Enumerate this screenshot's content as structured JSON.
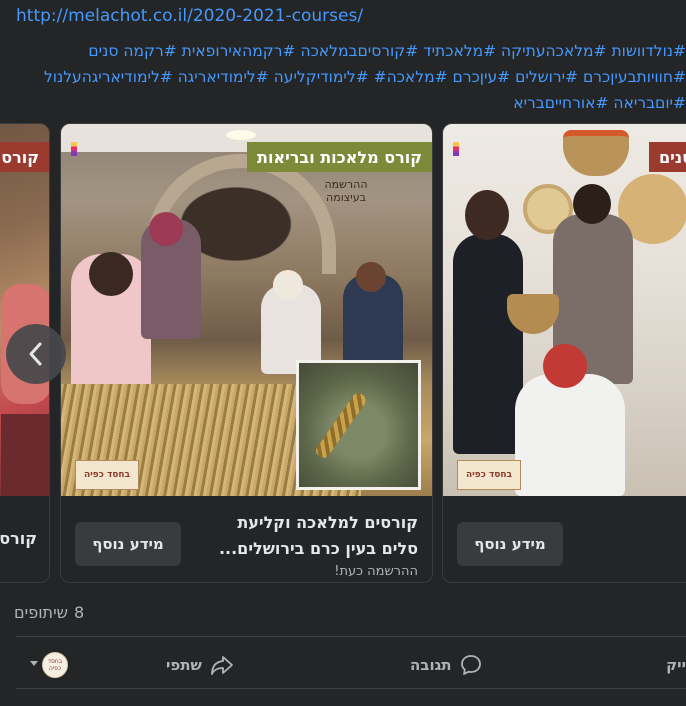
{
  "post": {
    "link": "http://melachot.co.il/2020-2021-courses/",
    "hashtag_lines": [
      "#נולדוושות #מלאכהעתיקה #מלאכתיד #קורסיםבמלאכה #רקמהאירופאית #רקמה סנים",
      "#חוויותבעיןכרם #ירושלים #עיןכרם #מלאכה# #לימודיקליעה #לימודיאריגה #לימודיאריגהעלנול",
      "#יוםבריאה #אורחייםבריא"
    ]
  },
  "carousel": {
    "prev_icon": "chevron-left-icon",
    "cards": [
      {
        "title_partial": "קורס",
        "banner": "קורס",
        "banner_color": "#9b3a2f"
      },
      {
        "banner": "קורס מלאכות ובריאות",
        "banner_color": "#7c8a39",
        "stamp": "ההרשמה בעיצומה",
        "logo": "בחסד כפיה",
        "title_line1": "קורסים למלאכה וקליעת",
        "title_line2": "סלים בעין כרם בירושלים...",
        "subtitle": "ההרשמה כעת!",
        "button": "מידע נוסף"
      },
      {
        "banner": "סנים",
        "banner_color": "#9b3a2f",
        "logo": "בחסד כפיה",
        "button": "מידע נוסף"
      }
    ]
  },
  "footer": {
    "shares_count": "8",
    "shares_label": "שיתופים",
    "like_label": "ייק",
    "comment_label": "תגובה",
    "share_label": "שתפי",
    "avatar_text": "בחסד כפיה",
    "icons": {
      "comment": "comment-icon",
      "share": "share-icon",
      "caret": "caret-down-icon"
    }
  }
}
